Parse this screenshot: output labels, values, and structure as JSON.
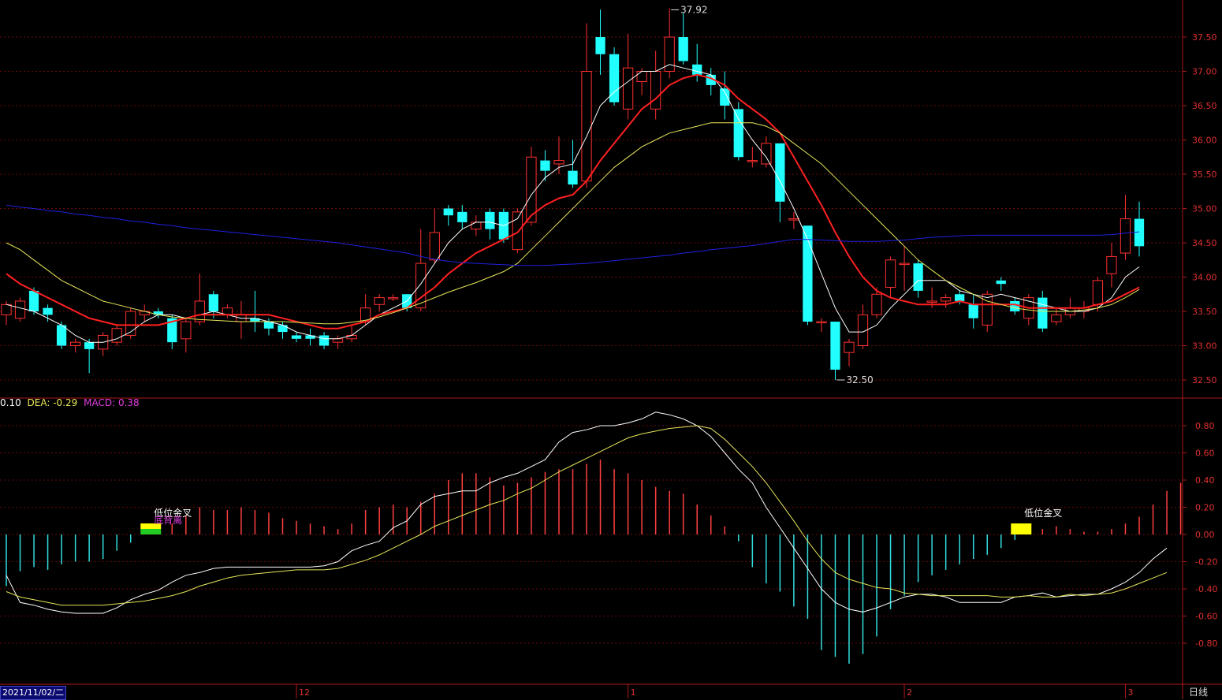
{
  "chart_data": [
    {
      "type": "candlestick",
      "ylim": [
        32.2,
        38.0
      ],
      "y_ticks": [
        "32.50",
        "33.00",
        "33.50",
        "34.00",
        "34.50",
        "35.00",
        "35.50",
        "36.00",
        "36.50",
        "37.00",
        "37.50"
      ],
      "x_ticks": [
        "12",
        "1",
        "2",
        "3"
      ],
      "high_annotation": "37.92",
      "low_annotation": "32.50",
      "candles": [
        [
          33.45,
          33.6,
          33.3,
          33.65
        ],
        [
          33.4,
          33.65,
          33.35,
          33.7
        ],
        [
          33.8,
          33.5,
          33.45,
          33.85
        ],
        [
          33.55,
          33.45,
          33.35,
          33.6
        ],
        [
          33.3,
          33.0,
          32.95,
          33.35
        ],
        [
          33.0,
          33.05,
          32.9,
          33.1
        ],
        [
          33.05,
          32.95,
          32.6,
          33.1
        ],
        [
          32.95,
          33.15,
          32.85,
          33.2
        ],
        [
          33.05,
          33.25,
          33.0,
          33.3
        ],
        [
          33.15,
          33.5,
          33.1,
          33.55
        ],
        [
          33.45,
          33.5,
          33.35,
          33.6
        ],
        [
          33.5,
          33.45,
          33.4,
          33.55
        ],
        [
          33.4,
          33.05,
          32.95,
          33.45
        ],
        [
          33.1,
          33.35,
          32.9,
          33.4
        ],
        [
          33.35,
          33.65,
          33.3,
          34.05
        ],
        [
          33.75,
          33.5,
          33.4,
          33.8
        ],
        [
          33.45,
          33.55,
          33.4,
          33.6
        ],
        [
          33.35,
          33.45,
          33.1,
          33.65
        ],
        [
          33.4,
          33.35,
          33.2,
          33.8
        ],
        [
          33.35,
          33.25,
          33.15,
          33.4
        ],
        [
          33.3,
          33.2,
          33.1,
          33.35
        ],
        [
          33.15,
          33.1,
          33.05,
          33.2
        ],
        [
          33.15,
          33.1,
          33.0,
          33.25
        ],
        [
          33.15,
          33.0,
          32.95,
          33.2
        ],
        [
          33.05,
          33.1,
          32.95,
          33.15
        ],
        [
          33.1,
          33.15,
          33.05,
          33.3
        ],
        [
          33.35,
          33.55,
          33.3,
          33.75
        ],
        [
          33.6,
          33.7,
          33.5,
          33.75
        ],
        [
          33.7,
          33.7,
          33.65,
          33.75
        ],
        [
          33.75,
          33.55,
          33.5,
          33.75
        ],
        [
          33.55,
          34.2,
          33.5,
          34.7
        ],
        [
          34.25,
          34.65,
          34.2,
          35.0
        ],
        [
          35.0,
          34.9,
          34.75,
          35.05
        ],
        [
          34.95,
          34.8,
          34.7,
          35.05
        ],
        [
          34.7,
          34.8,
          34.6,
          34.9
        ],
        [
          34.95,
          34.7,
          34.55,
          35.0
        ],
        [
          34.95,
          34.55,
          34.5,
          35.0
        ],
        [
          34.4,
          34.95,
          34.35,
          35.0
        ],
        [
          34.8,
          35.75,
          34.75,
          35.9
        ],
        [
          35.7,
          35.55,
          35.4,
          35.85
        ],
        [
          35.65,
          35.7,
          35.5,
          36.05
        ],
        [
          35.55,
          35.35,
          35.3,
          36.0
        ],
        [
          35.4,
          37.0,
          35.3,
          37.7
        ],
        [
          37.5,
          37.25,
          36.95,
          37.9
        ],
        [
          37.25,
          36.55,
          36.5,
          37.35
        ],
        [
          36.45,
          37.05,
          36.3,
          37.55
        ],
        [
          36.85,
          37.0,
          36.65,
          37.05
        ],
        [
          36.45,
          37.0,
          36.3,
          37.3
        ],
        [
          37.0,
          37.5,
          36.9,
          37.92
        ],
        [
          37.5,
          37.15,
          37.1,
          37.85
        ],
        [
          37.1,
          36.95,
          36.85,
          37.4
        ],
        [
          36.95,
          36.8,
          36.65,
          37.05
        ],
        [
          36.75,
          36.5,
          36.3,
          37.0
        ],
        [
          36.45,
          35.75,
          35.7,
          36.55
        ],
        [
          35.7,
          35.7,
          35.6,
          35.9
        ],
        [
          35.65,
          35.95,
          35.6,
          36.05
        ],
        [
          35.95,
          35.1,
          34.8,
          35.95
        ],
        [
          34.85,
          34.85,
          34.7,
          34.95
        ],
        [
          34.75,
          33.35,
          33.3,
          34.75
        ],
        [
          33.35,
          33.35,
          33.2,
          33.4
        ],
        [
          33.35,
          32.65,
          32.5,
          33.35
        ],
        [
          32.9,
          33.05,
          32.7,
          33.1
        ],
        [
          33.0,
          33.45,
          32.95,
          33.6
        ],
        [
          33.45,
          33.75,
          33.4,
          33.85
        ],
        [
          33.85,
          34.25,
          33.7,
          34.3
        ],
        [
          34.2,
          34.2,
          33.8,
          34.45
        ],
        [
          34.2,
          33.8,
          33.7,
          34.25
        ],
        [
          33.65,
          33.65,
          33.55,
          33.85
        ],
        [
          33.65,
          33.7,
          33.55,
          33.75
        ],
        [
          33.75,
          33.65,
          33.6,
          33.8
        ],
        [
          33.6,
          33.4,
          33.25,
          33.75
        ],
        [
          33.3,
          33.75,
          33.2,
          33.8
        ],
        [
          33.95,
          33.9,
          33.8,
          34.0
        ],
        [
          33.65,
          33.5,
          33.45,
          33.7
        ],
        [
          33.4,
          33.7,
          33.3,
          33.75
        ],
        [
          33.7,
          33.25,
          33.2,
          33.8
        ],
        [
          33.35,
          33.45,
          33.3,
          33.55
        ],
        [
          33.45,
          33.55,
          33.4,
          33.7
        ],
        [
          33.5,
          33.55,
          33.4,
          33.65
        ],
        [
          33.6,
          33.95,
          33.5,
          34.0
        ],
        [
          34.05,
          34.3,
          33.85,
          34.5
        ],
        [
          34.35,
          34.85,
          34.25,
          35.2
        ],
        [
          34.85,
          34.45,
          34.3,
          35.1
        ]
      ],
      "ma_series": [
        {
          "color": "#ffffff",
          "values": [
            33.6,
            33.55,
            33.5,
            33.4,
            33.3,
            33.15,
            33.05,
            33.05,
            33.1,
            33.2,
            33.35,
            33.45,
            33.45,
            33.4,
            33.45,
            33.5,
            33.45,
            33.4,
            33.4,
            33.35,
            33.3,
            33.2,
            33.15,
            33.1,
            33.1,
            33.15,
            33.3,
            33.45,
            33.55,
            33.65,
            33.9,
            34.2,
            34.5,
            34.7,
            34.8,
            34.8,
            34.75,
            34.85,
            35.2,
            35.45,
            35.6,
            35.65,
            36.05,
            36.5,
            36.7,
            36.85,
            37.0,
            37.0,
            37.1,
            37.05,
            37.0,
            36.95,
            36.7,
            36.3,
            36.0,
            35.75,
            35.4,
            35.0,
            34.55,
            34.05,
            33.55,
            33.2,
            33.2,
            33.3,
            33.55,
            33.75,
            33.95,
            33.95,
            33.95,
            33.8,
            33.75,
            33.7,
            33.75,
            33.7,
            33.65,
            33.6,
            33.55,
            33.5,
            33.5,
            33.55,
            33.7,
            34.0,
            34.15
          ]
        },
        {
          "color": "#ff2020",
          "values": [
            34.05,
            33.9,
            33.8,
            33.7,
            33.6,
            33.5,
            33.4,
            33.35,
            33.3,
            33.3,
            33.3,
            33.3,
            33.35,
            33.4,
            33.45,
            33.45,
            33.45,
            33.45,
            33.45,
            33.45,
            33.4,
            33.35,
            33.3,
            33.25,
            33.25,
            33.3,
            33.35,
            33.45,
            33.5,
            33.55,
            33.7,
            33.85,
            34.05,
            34.2,
            34.35,
            34.45,
            34.55,
            34.65,
            34.9,
            35.05,
            35.15,
            35.2,
            35.4,
            35.7,
            35.95,
            36.2,
            36.45,
            36.6,
            36.8,
            36.9,
            36.95,
            36.9,
            36.8,
            36.6,
            36.45,
            36.3,
            36.1,
            35.75,
            35.4,
            35.05,
            34.65,
            34.3,
            34.0,
            33.8,
            33.7,
            33.65,
            33.6,
            33.6,
            33.6,
            33.65,
            33.6,
            33.6,
            33.6,
            33.6,
            33.55,
            33.55,
            33.55,
            33.55,
            33.55,
            33.6,
            33.65,
            33.75,
            33.85
          ]
        },
        {
          "color": "#e6e65a",
          "values": [
            34.5,
            34.4,
            34.25,
            34.1,
            33.95,
            33.85,
            33.75,
            33.65,
            33.6,
            33.55,
            33.5,
            33.45,
            33.42,
            33.4,
            33.38,
            33.37,
            33.36,
            33.35,
            33.35,
            33.35,
            33.35,
            33.34,
            33.33,
            33.32,
            33.32,
            33.34,
            33.37,
            33.42,
            33.48,
            33.55,
            33.62,
            33.7,
            33.78,
            33.85,
            33.92,
            34.0,
            34.08,
            34.2,
            34.4,
            34.6,
            34.8,
            35.0,
            35.2,
            35.4,
            35.6,
            35.75,
            35.9,
            36.0,
            36.1,
            36.15,
            36.2,
            36.25,
            36.25,
            36.25,
            36.25,
            36.2,
            36.1,
            35.95,
            35.8,
            35.65,
            35.45,
            35.25,
            35.05,
            34.85,
            34.65,
            34.45,
            34.25,
            34.1,
            33.95,
            33.85,
            33.75,
            33.65,
            33.6,
            33.55,
            33.52,
            33.5,
            33.5,
            33.5,
            33.52,
            33.55,
            33.6,
            33.7,
            33.82
          ]
        },
        {
          "color": "#2020e0",
          "values": [
            35.05,
            35.02,
            35.0,
            34.97,
            34.95,
            34.92,
            34.9,
            34.87,
            34.85,
            34.82,
            34.8,
            34.77,
            34.75,
            34.72,
            34.7,
            34.68,
            34.66,
            34.64,
            34.62,
            34.6,
            34.58,
            34.56,
            34.54,
            34.52,
            34.5,
            34.47,
            34.44,
            34.41,
            34.38,
            34.35,
            34.3,
            34.26,
            34.23,
            34.21,
            34.2,
            34.19,
            34.18,
            34.17,
            34.17,
            34.17,
            34.18,
            34.19,
            34.2,
            34.22,
            34.24,
            34.26,
            34.28,
            34.3,
            34.32,
            34.35,
            34.37,
            34.4,
            34.42,
            34.44,
            34.46,
            34.49,
            34.52,
            34.55,
            34.55,
            34.54,
            34.53,
            34.52,
            34.52,
            34.52,
            34.53,
            34.54,
            34.56,
            34.58,
            34.59,
            34.6,
            34.61,
            34.61,
            34.61,
            34.61,
            34.61,
            34.61,
            34.61,
            34.61,
            34.61,
            34.61,
            34.62,
            34.64,
            34.66
          ]
        }
      ]
    },
    {
      "type": "macd",
      "ylim": [
        -1.08,
        0.98
      ],
      "y_ticks": [
        "0.80",
        "0.60",
        "0.40",
        "0.20",
        "0.00",
        "-0.20",
        "-0.40",
        "-0.60",
        "-0.80"
      ],
      "header": {
        "dif": "0.10",
        "dea_label": "DEA: -0.29",
        "macd_label": "MACD: 0.38"
      },
      "signals": [
        {
          "label": "低位金叉",
          "sub": "底背离",
          "index": 10
        },
        {
          "label": "低位金叉",
          "sub": "",
          "index": 73
        }
      ],
      "bars": [
        -0.38,
        -0.27,
        -0.24,
        -0.26,
        -0.22,
        -0.2,
        -0.2,
        -0.18,
        -0.12,
        -0.06,
        0.02,
        0.04,
        0.08,
        0.14,
        0.2,
        0.18,
        0.18,
        0.2,
        0.18,
        0.16,
        0.12,
        0.1,
        0.08,
        0.06,
        0.04,
        0.08,
        0.18,
        0.2,
        0.22,
        0.2,
        0.24,
        0.3,
        0.4,
        0.45,
        0.45,
        0.42,
        0.36,
        0.38,
        0.42,
        0.46,
        0.48,
        0.48,
        0.52,
        0.55,
        0.48,
        0.45,
        0.4,
        0.35,
        0.32,
        0.3,
        0.22,
        0.14,
        0.06,
        -0.05,
        -0.24,
        -0.36,
        -0.42,
        -0.53,
        -0.62,
        -0.85,
        -0.9,
        -0.95,
        -0.88,
        -0.75,
        -0.55,
        -0.45,
        -0.35,
        -0.3,
        -0.26,
        -0.22,
        -0.18,
        -0.15,
        -0.1,
        -0.04,
        0.02,
        0.04,
        0.06,
        0.04,
        0.02,
        0.02,
        0.04,
        0.08,
        0.13,
        0.22,
        0.32,
        0.38
      ],
      "dif": [
        -0.3,
        -0.5,
        -0.52,
        -0.55,
        -0.57,
        -0.58,
        -0.58,
        -0.58,
        -0.54,
        -0.48,
        -0.44,
        -0.41,
        -0.35,
        -0.3,
        -0.28,
        -0.25,
        -0.24,
        -0.24,
        -0.24,
        -0.24,
        -0.24,
        -0.24,
        -0.24,
        -0.23,
        -0.2,
        -0.12,
        -0.08,
        -0.05,
        0.05,
        0.1,
        0.22,
        0.28,
        0.3,
        0.32,
        0.32,
        0.38,
        0.42,
        0.45,
        0.5,
        0.55,
        0.68,
        0.75,
        0.77,
        0.8,
        0.8,
        0.82,
        0.85,
        0.9,
        0.88,
        0.85,
        0.8,
        0.72,
        0.6,
        0.48,
        0.38,
        0.2,
        0.05,
        -0.1,
        -0.25,
        -0.4,
        -0.5,
        -0.55,
        -0.57,
        -0.54,
        -0.5,
        -0.46,
        -0.44,
        -0.44,
        -0.46,
        -0.5,
        -0.5,
        -0.5,
        -0.5,
        -0.46,
        -0.45,
        -0.43,
        -0.46,
        -0.45,
        -0.44,
        -0.44,
        -0.4,
        -0.35,
        -0.28,
        -0.18,
        -0.1
      ],
      "dea": [
        -0.42,
        -0.46,
        -0.48,
        -0.5,
        -0.52,
        -0.52,
        -0.52,
        -0.52,
        -0.51,
        -0.5,
        -0.49,
        -0.47,
        -0.45,
        -0.42,
        -0.38,
        -0.35,
        -0.32,
        -0.3,
        -0.29,
        -0.28,
        -0.27,
        -0.26,
        -0.26,
        -0.26,
        -0.25,
        -0.22,
        -0.19,
        -0.15,
        -0.1,
        -0.05,
        0.0,
        0.06,
        0.1,
        0.14,
        0.18,
        0.22,
        0.25,
        0.3,
        0.34,
        0.4,
        0.46,
        0.51,
        0.56,
        0.61,
        0.66,
        0.71,
        0.74,
        0.76,
        0.78,
        0.79,
        0.8,
        0.78,
        0.7,
        0.6,
        0.5,
        0.38,
        0.24,
        0.1,
        -0.05,
        -0.18,
        -0.28,
        -0.33,
        -0.36,
        -0.39,
        -0.4,
        -0.43,
        -0.44,
        -0.45,
        -0.45,
        -0.45,
        -0.45,
        -0.45,
        -0.46,
        -0.46,
        -0.45,
        -0.46,
        -0.46,
        -0.44,
        -0.45,
        -0.44,
        -0.43,
        -0.4,
        -0.36,
        -0.32,
        -0.28
      ]
    }
  ],
  "footer": {
    "date": "2021/11/02/二",
    "period": "日线"
  }
}
